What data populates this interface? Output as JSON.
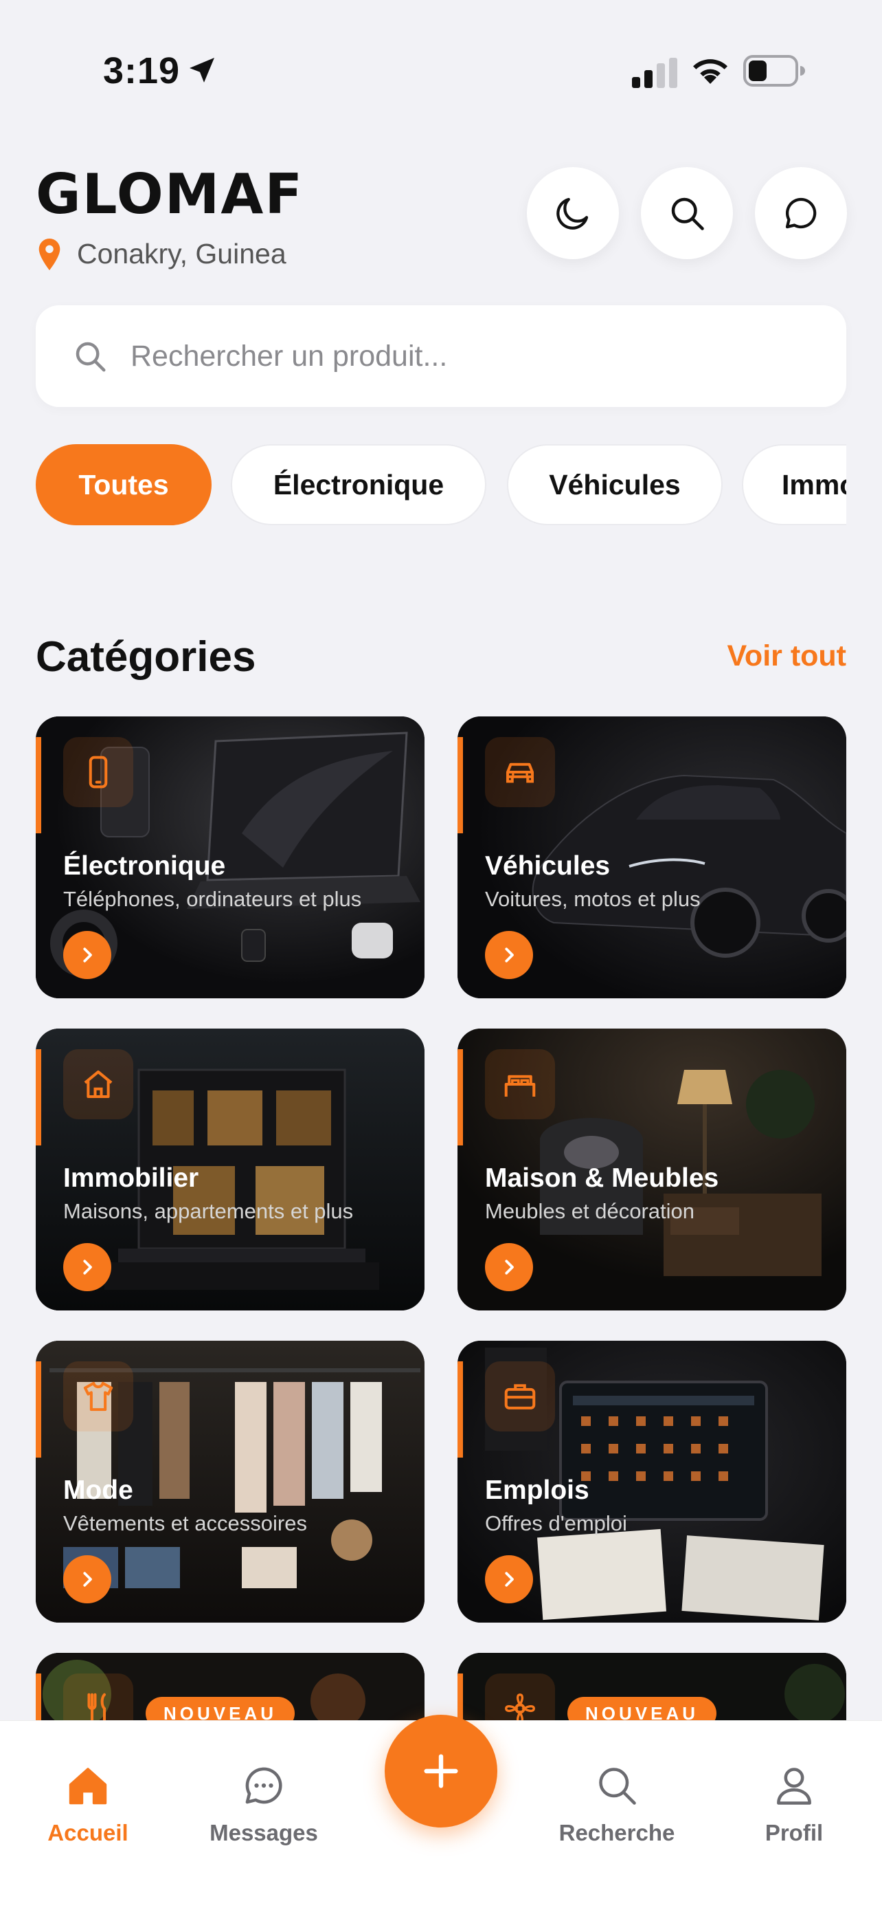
{
  "status_bar": {
    "time": "3:19"
  },
  "header": {
    "brand": "GLOMAF",
    "location": "Conakry, Guinea",
    "buttons": [
      {
        "name": "theme-toggle-button",
        "icon": "moon-icon"
      },
      {
        "name": "search-button",
        "icon": "search-icon"
      },
      {
        "name": "chat-button",
        "icon": "chat-bubble-icon"
      }
    ]
  },
  "search": {
    "placeholder": "Rechercher un produit..."
  },
  "filters": {
    "chips": [
      "Toutes",
      "Électronique",
      "Véhicules",
      "Immo"
    ],
    "active": "Toutes"
  },
  "categories_section": {
    "title": "Catégories",
    "see_all": "Voir tout",
    "cards": [
      {
        "title": "Électronique",
        "subtitle": "Téléphones, ordinateurs et plus",
        "icon": "phone-icon"
      },
      {
        "title": "Véhicules",
        "subtitle": "Voitures, motos et plus",
        "icon": "car-icon"
      },
      {
        "title": "Immobilier",
        "subtitle": "Maisons, appartements et plus",
        "icon": "house-icon"
      },
      {
        "title": "Maison & Meubles",
        "subtitle": "Meubles et décoration",
        "icon": "bed-icon"
      },
      {
        "title": "Mode",
        "subtitle": "Vêtements et accessoires",
        "icon": "shirt-icon"
      },
      {
        "title": "Emplois",
        "subtitle": "Offres d'emploi",
        "icon": "briefcase-icon"
      },
      {
        "badge": "NOUVEAU",
        "icon": "utensils-icon"
      },
      {
        "badge": "NOUVEAU",
        "icon": "flower-icon"
      }
    ]
  },
  "tab_bar": {
    "tabs": [
      {
        "label": "Accueil",
        "icon": "home-icon",
        "active": true
      },
      {
        "label": "Messages",
        "icon": "messages-icon",
        "active": false
      },
      {
        "label": "Recherche",
        "icon": "search-icon",
        "active": false
      },
      {
        "label": "Profil",
        "icon": "user-icon",
        "active": false
      }
    ],
    "fab_icon": "plus-icon"
  },
  "colors": {
    "accent": "#f7781c",
    "background": "#f2f2f6",
    "card": "#111111"
  }
}
